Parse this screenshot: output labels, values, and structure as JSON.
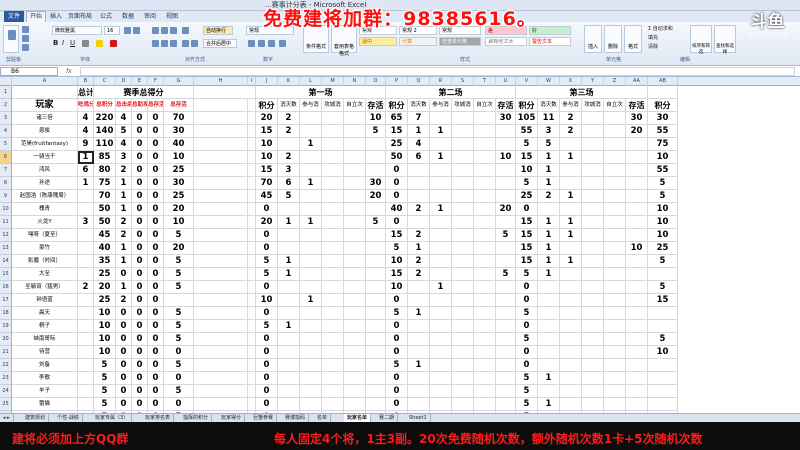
{
  "window": {
    "title": "...赛事计分表 - Microsoft Excel"
  },
  "promo": {
    "text": "免费建将加群：98385616。"
  },
  "logo": {
    "big": "斗鱼",
    "small": "DOUYU.COM"
  },
  "ribbon": {
    "tabs": [
      "文件",
      "开始",
      "插入",
      "页面布局",
      "公式",
      "数据",
      "审阅",
      "视图"
    ],
    "font_name": "微软雅黑",
    "font_size": "16",
    "number_format": "常规",
    "autofit_label": "自动换行",
    "merge_label": "合并后居中",
    "cond_format": "条件格式",
    "table_format": "套用表格格式",
    "styles": [
      "常规",
      "常规 2",
      "常规",
      "差",
      "好",
      "适中",
      "计算",
      "检查单元格",
      "解释性文本",
      "警告文本"
    ],
    "insert": "插入",
    "delete": "删除",
    "format": "格式",
    "autosum": "自动求和",
    "fill": "填充",
    "clear": "清除",
    "sort": "排序和筛选",
    "find": "查找和选择",
    "groups": [
      "剪贴板",
      "字体",
      "对齐方式",
      "数字",
      "样式",
      "单元格",
      "编辑"
    ]
  },
  "formula_bar": {
    "name_box": "B6",
    "fx": "fx"
  },
  "columns": [
    "A",
    "B",
    "C",
    "D",
    "E",
    "F",
    "G",
    "H",
    "I",
    "J",
    "K",
    "L",
    "M",
    "N",
    "O",
    "P",
    "Q",
    "R",
    "S",
    "T",
    "U",
    "V",
    "W",
    "X",
    "Y",
    "Z",
    "AA",
    "AB"
  ],
  "row_numbers": [
    "1",
    "2",
    "3",
    "4",
    "5",
    "6",
    "7",
    "8",
    "9",
    "10",
    "11",
    "12",
    "13",
    "14",
    "15",
    "16",
    "17",
    "18",
    "19",
    "20",
    "21",
    "22",
    "23",
    "24",
    "25",
    "26",
    "27"
  ],
  "headers": {
    "total": "总计",
    "season": "赛季总得分",
    "g1": "第一场",
    "g2": "第二场",
    "g3": "第三场",
    "player": "玩家",
    "sub_total": [
      "吃鸡分",
      "总积分",
      "总击杀",
      "总助攻",
      "总存活",
      "总存活"
    ],
    "sub_game": [
      "积分",
      "消灭数",
      "参与消",
      "攻城消",
      "自立次",
      "存活"
    ]
  },
  "players": [
    {
      "name": "诸三倍",
      "total": "4",
      "pts": "220",
      "k": "4",
      "a": "0",
      "s": "0",
      "g": "70",
      "g1": [
        "20",
        "2",
        "",
        "",
        "",
        "10"
      ],
      "g2": [
        "65",
        "7",
        "",
        "",
        "",
        "30"
      ],
      "g3": [
        "105",
        "11",
        "2",
        "",
        "",
        "30",
        "30"
      ]
    },
    {
      "name": "恩俊",
      "total": "4",
      "pts": "140",
      "k": "5",
      "a": "0",
      "s": "0",
      "g": "30",
      "g1": [
        "15",
        "2",
        "",
        "",
        "",
        "5"
      ],
      "g2": [
        "15",
        "1",
        "1",
        "",
        "",
        ""
      ],
      "g3": [
        "55",
        "3",
        "2",
        "",
        "",
        "20",
        "55",
        "6"
      ]
    },
    {
      "name": "范昊(fruitfantasy)",
      "total": "9",
      "pts": "110",
      "k": "4",
      "a": "0",
      "s": "0",
      "g": "40",
      "g1": [
        "10",
        "",
        "1",
        "",
        "",
        ""
      ],
      "g2": [
        "25",
        "4",
        "",
        "",
        "",
        ""
      ],
      "g3": [
        "5",
        "5",
        "",
        "",
        "",
        "",
        "75",
        "2"
      ]
    },
    {
      "name": "一骑当千",
      "total": "1",
      "pts": "85",
      "k": "3",
      "a": "0",
      "s": "0",
      "g": "10",
      "g1": [
        "10",
        "2",
        "",
        "",
        "",
        ""
      ],
      "g2": [
        "50",
        "6",
        "1",
        "",
        "",
        "10"
      ],
      "g3": [
        "15",
        "1",
        "1",
        "",
        "",
        "",
        "10",
        "1"
      ]
    },
    {
      "name": "鸿风",
      "total": "6",
      "pts": "80",
      "k": "2",
      "a": "0",
      "s": "0",
      "g": "25",
      "g1": [
        "15",
        "3",
        "",
        "",
        "",
        ""
      ],
      "g2": [
        "0",
        "",
        "",
        "",
        "",
        ""
      ],
      "g3": [
        "10",
        "1",
        "",
        "",
        "",
        "",
        "55",
        "3"
      ]
    },
    {
      "name": "孙途",
      "total": "1",
      "pts": "75",
      "k": "1",
      "a": "0",
      "s": "0",
      "g": "30",
      "g1": [
        "70",
        "6",
        "1",
        "",
        "",
        "30"
      ],
      "g2": [
        "0",
        "",
        "",
        "",
        "",
        ""
      ],
      "g3": [
        "5",
        "1",
        "",
        "",
        "",
        "",
        "5",
        "1"
      ]
    },
    {
      "name": "赵国浩（陈康隗周）",
      "total": "",
      "pts": "70",
      "k": "1",
      "a": "0",
      "s": "0",
      "g": "25",
      "g1": [
        "45",
        "5",
        "",
        "",
        "",
        "20"
      ],
      "g2": [
        "0",
        "",
        "",
        "",
        "",
        ""
      ],
      "g3": [
        "25",
        "2",
        "1",
        "",
        "",
        "",
        "5",
        "1"
      ]
    },
    {
      "name": "槐青",
      "total": "",
      "pts": "50",
      "k": "1",
      "a": "0",
      "s": "0",
      "g": "20",
      "g1": [
        "0",
        "",
        "",
        "",
        "",
        ""
      ],
      "g2": [
        "40",
        "2",
        "1",
        "",
        "",
        "20"
      ],
      "g3": [
        "0",
        "",
        "",
        "",
        "",
        "",
        "10",
        "2"
      ]
    },
    {
      "name": "火龙Y",
      "total": "3",
      "pts": "50",
      "k": "2",
      "a": "0",
      "s": "0",
      "g": "10",
      "g1": [
        "20",
        "1",
        "1",
        "",
        "",
        "5"
      ],
      "g2": [
        "0",
        "",
        "",
        "",
        "",
        ""
      ],
      "g3": [
        "15",
        "1",
        "1",
        "",
        "",
        "",
        "10",
        "2"
      ]
    },
    {
      "name": "嘿呀（夏至）",
      "total": "",
      "pts": "45",
      "k": "2",
      "a": "0",
      "s": "0",
      "g": "5",
      "g1": [
        "0",
        "",
        "",
        "",
        "",
        ""
      ],
      "g2": [
        "15",
        "2",
        "",
        "",
        "",
        "5"
      ],
      "g3": [
        "15",
        "1",
        "1",
        "",
        "",
        "",
        "10",
        "2"
      ]
    },
    {
      "name": "豪竹",
      "total": "",
      "pts": "40",
      "k": "1",
      "a": "0",
      "s": "0",
      "g": "20",
      "g1": [
        "0",
        "",
        "",
        "",
        "",
        ""
      ],
      "g2": [
        "5",
        "1",
        "",
        "",
        "",
        ""
      ],
      "g3": [
        "15",
        "1",
        "",
        "",
        "",
        "10",
        "25",
        "1"
      ]
    },
    {
      "name": "影魔（时间）",
      "total": "",
      "pts": "35",
      "k": "1",
      "a": "0",
      "s": "0",
      "g": "5",
      "g1": [
        "5",
        "1",
        "",
        "",
        "",
        ""
      ],
      "g2": [
        "10",
        "2",
        "",
        "",
        "",
        ""
      ],
      "g3": [
        "15",
        "1",
        "1",
        "",
        "",
        "",
        "5",
        "1"
      ]
    },
    {
      "name": "大至",
      "total": "",
      "pts": "25",
      "k": "0",
      "a": "0",
      "s": "0",
      "g": "5",
      "g1": [
        "5",
        "1",
        "",
        "",
        "",
        ""
      ],
      "g2": [
        "15",
        "2",
        "",
        "",
        "",
        "5"
      ],
      "g3": [
        "5",
        "1",
        "",
        "",
        "",
        "",
        "",
        ""
      ]
    },
    {
      "name": "圣毓宵（猛男）",
      "total": "2",
      "pts": "20",
      "k": "1",
      "a": "0",
      "s": "0",
      "g": "5",
      "g1": [
        "0",
        "",
        "",
        "",
        "",
        ""
      ],
      "g2": [
        "10",
        "",
        "1",
        "",
        "",
        ""
      ],
      "g3": [
        "0",
        "",
        "",
        "",
        "",
        "",
        "5",
        "1"
      ]
    },
    {
      "name": "钟语蓝",
      "total": "",
      "pts": "25",
      "k": "2",
      "a": "0",
      "s": "0",
      "g": "",
      "g1": [
        "10",
        "",
        "1",
        "",
        "",
        ""
      ],
      "g2": [
        "0",
        "",
        "",
        "",
        "",
        ""
      ],
      "g3": [
        "0",
        "",
        "",
        "",
        "",
        "",
        "15",
        "1"
      ]
    },
    {
      "name": "晨天",
      "total": "",
      "pts": "10",
      "k": "0",
      "a": "0",
      "s": "0",
      "g": "5",
      "g1": [
        "0",
        "",
        "",
        "",
        "",
        ""
      ],
      "g2": [
        "5",
        "1",
        "",
        "",
        "",
        ""
      ],
      "g3": [
        "5",
        "",
        "",
        "",
        "",
        "",
        "",
        ""
      ]
    },
    {
      "name": "桐子",
      "total": "",
      "pts": "10",
      "k": "0",
      "a": "0",
      "s": "0",
      "g": "5",
      "g1": [
        "5",
        "1",
        "",
        "",
        "",
        ""
      ],
      "g2": [
        "0",
        "",
        "",
        "",
        "",
        ""
      ],
      "g3": [
        "0",
        "",
        "",
        "",
        "",
        "",
        "",
        ""
      ]
    },
    {
      "name": "峡南哥际",
      "total": "",
      "pts": "10",
      "k": "0",
      "a": "0",
      "s": "0",
      "g": "5",
      "g1": [
        "0",
        "",
        "",
        "",
        "",
        ""
      ],
      "g2": [
        "0",
        "",
        "",
        "",
        "",
        ""
      ],
      "g3": [
        "5",
        "",
        "",
        "",
        "",
        "",
        "5",
        "1"
      ]
    },
    {
      "name": "待营",
      "total": "",
      "pts": "10",
      "k": "0",
      "a": "0",
      "s": "0",
      "g": "0",
      "g1": [
        "0",
        "",
        "",
        "",
        "",
        ""
      ],
      "g2": [
        "0",
        "",
        "",
        "",
        "",
        ""
      ],
      "g3": [
        "0",
        "",
        "",
        "",
        "",
        "",
        "10",
        "2"
      ]
    },
    {
      "name": "刘备",
      "total": "",
      "pts": "5",
      "k": "0",
      "a": "0",
      "s": "0",
      "g": "5",
      "g1": [
        "0",
        "",
        "",
        "",
        "",
        ""
      ],
      "g2": [
        "5",
        "1",
        "",
        "",
        "",
        ""
      ],
      "g3": [
        "0",
        "",
        "",
        "",
        "",
        "",
        "",
        ""
      ]
    },
    {
      "name": "李歌",
      "total": "",
      "pts": "5",
      "k": "0",
      "a": "0",
      "s": "0",
      "g": "0",
      "g1": [
        "0",
        "",
        "",
        "",
        "",
        ""
      ],
      "g2": [
        "0",
        "",
        "",
        "",
        "",
        ""
      ],
      "g3": [
        "5",
        "1",
        "",
        "",
        "",
        "",
        "",
        ""
      ]
    },
    {
      "name": "羊子",
      "total": "",
      "pts": "5",
      "k": "0",
      "a": "0",
      "s": "0",
      "g": "5",
      "g1": [
        "0",
        "",
        "",
        "",
        "",
        ""
      ],
      "g2": [
        "0",
        "",
        "",
        "",
        "",
        ""
      ],
      "g3": [
        "5",
        "",
        "",
        "",
        "",
        "",
        "",
        ""
      ]
    },
    {
      "name": "蕾猫",
      "total": "",
      "pts": "5",
      "k": "0",
      "a": "0",
      "s": "0",
      "g": "0",
      "g1": [
        "0",
        "",
        "",
        "",
        "",
        ""
      ],
      "g2": [
        "0",
        "",
        "",
        "",
        "",
        ""
      ],
      "g3": [
        "5",
        "1",
        "",
        "",
        "",
        "",
        "",
        ""
      ]
    },
    {
      "name": "千菜",
      "total": "",
      "pts": "5",
      "k": "0",
      "a": "0",
      "s": "0",
      "g": "5",
      "g1": [
        "0",
        "",
        "",
        "",
        "",
        ""
      ],
      "g2": [
        "0",
        "",
        "",
        "",
        "",
        ""
      ],
      "g3": [
        "5",
        "",
        "",
        "",
        "",
        "",
        "",
        ""
      ]
    },
    {
      "name": "小法子",
      "total": "3",
      "pts": "0",
      "k": "0",
      "a": "0",
      "s": "0",
      "g": "0",
      "g1": [
        "0",
        "",
        "",
        "",
        "",
        ""
      ],
      "g2": [
        "0",
        "",
        "",
        "",
        "",
        ""
      ],
      "g3": [
        "0",
        "",
        "",
        "",
        "",
        "",
        "",
        ""
      ]
    }
  ],
  "sheets": [
    "建筑规划",
    "个性-战绩",
    "玩家专属（3）",
    "玩家排名表",
    "指挥的积分",
    "玩家得分",
    "巨蟹参赛",
    "赛博指码",
    "名单",
    "玩家名单",
    "赛二期",
    "Sheet1"
  ],
  "banner": {
    "left": "建将必须加上方QQ群",
    "right": "每人固定4个将，1主3副。20次免费随机次数，额外随机次数1卡+5次随机次数"
  }
}
